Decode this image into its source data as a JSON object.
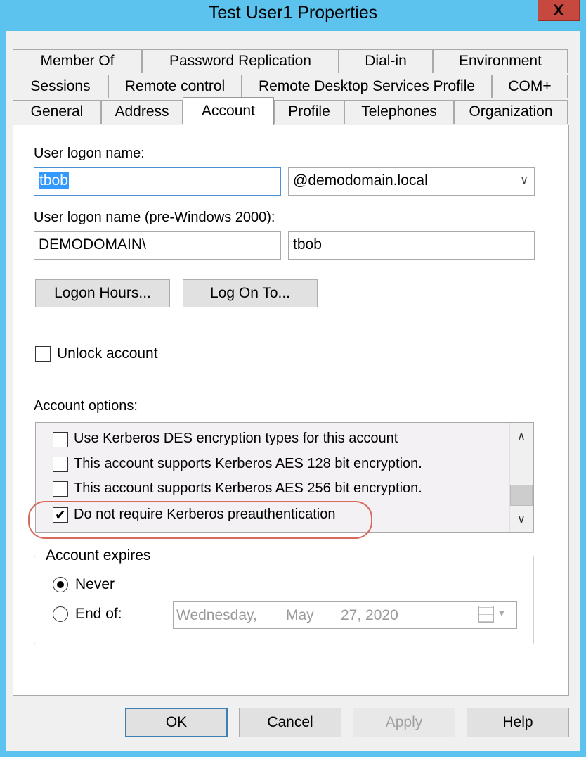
{
  "window": {
    "title": "Test User1 Properties",
    "close_symbol": "X"
  },
  "tabs": {
    "row1": [
      "Member Of",
      "Password Replication",
      "Dial-in",
      "Environment"
    ],
    "row2": [
      "Sessions",
      "Remote control",
      "Remote Desktop Services Profile",
      "COM+"
    ],
    "row3": [
      "General",
      "Address",
      "Account",
      "Profile",
      "Telephones",
      "Organization"
    ],
    "active": "Account"
  },
  "logon": {
    "label": "User logon name:",
    "value": "tbob",
    "domain_suffix": "@demodomain.local",
    "pre2000_label": "User logon name (pre-Windows 2000):",
    "pre2000_domain": "DEMODOMAIN\\",
    "pre2000_value": "tbob"
  },
  "buttons": {
    "logon_hours": "Logon Hours...",
    "log_on_to": "Log On To...",
    "ok": "OK",
    "cancel": "Cancel",
    "apply": "Apply",
    "help": "Help"
  },
  "unlock": {
    "label": "Unlock account",
    "checked": false
  },
  "account_options": {
    "label": "Account options:",
    "items": [
      {
        "label": "Use Kerberos DES encryption types for this account",
        "checked": false
      },
      {
        "label": "This account supports Kerberos AES 128 bit encryption.",
        "checked": false
      },
      {
        "label": "This account supports Kerberos AES 256 bit encryption.",
        "checked": false
      },
      {
        "label": "Do not require Kerberos preauthentication",
        "checked": true
      }
    ]
  },
  "account_expires": {
    "legend": "Account expires",
    "never_label": "Never",
    "end_of_label": "End of:",
    "selected": "never",
    "date": {
      "weekday": "Wednesday,",
      "month": "May",
      "day_year": "27, 2020"
    }
  },
  "colors": {
    "highlight": "#d9685d",
    "title_bar": "#5bc3ee",
    "close_button": "#c7483f",
    "selection": "#3399ff"
  }
}
